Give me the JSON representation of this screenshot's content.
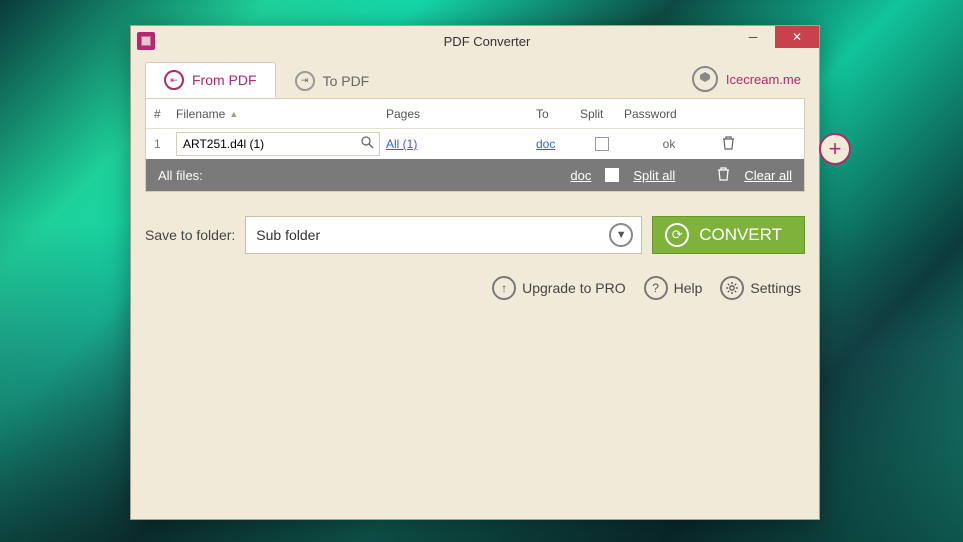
{
  "titlebar": {
    "title": "PDF Converter"
  },
  "tabs": {
    "from": "From PDF",
    "to": "To PDF"
  },
  "brand": {
    "label": "Icecream.me"
  },
  "table": {
    "headers": {
      "num": "#",
      "filename": "Filename",
      "pages": "Pages",
      "to": "To",
      "split": "Split",
      "password": "Password"
    },
    "rows": [
      {
        "num": "1",
        "filename": "ART251.d4l (1)",
        "pages": "All (1)",
        "to": "doc",
        "password": "ok"
      }
    ]
  },
  "summary": {
    "all_files": "All files:",
    "doc": "doc",
    "split_all": "Split all",
    "clear_all": "Clear all"
  },
  "save": {
    "label": "Save to folder:",
    "value": "Sub folder"
  },
  "convert": {
    "label": "CONVERT"
  },
  "footer": {
    "upgrade": "Upgrade to PRO",
    "help": "Help",
    "settings": "Settings"
  }
}
